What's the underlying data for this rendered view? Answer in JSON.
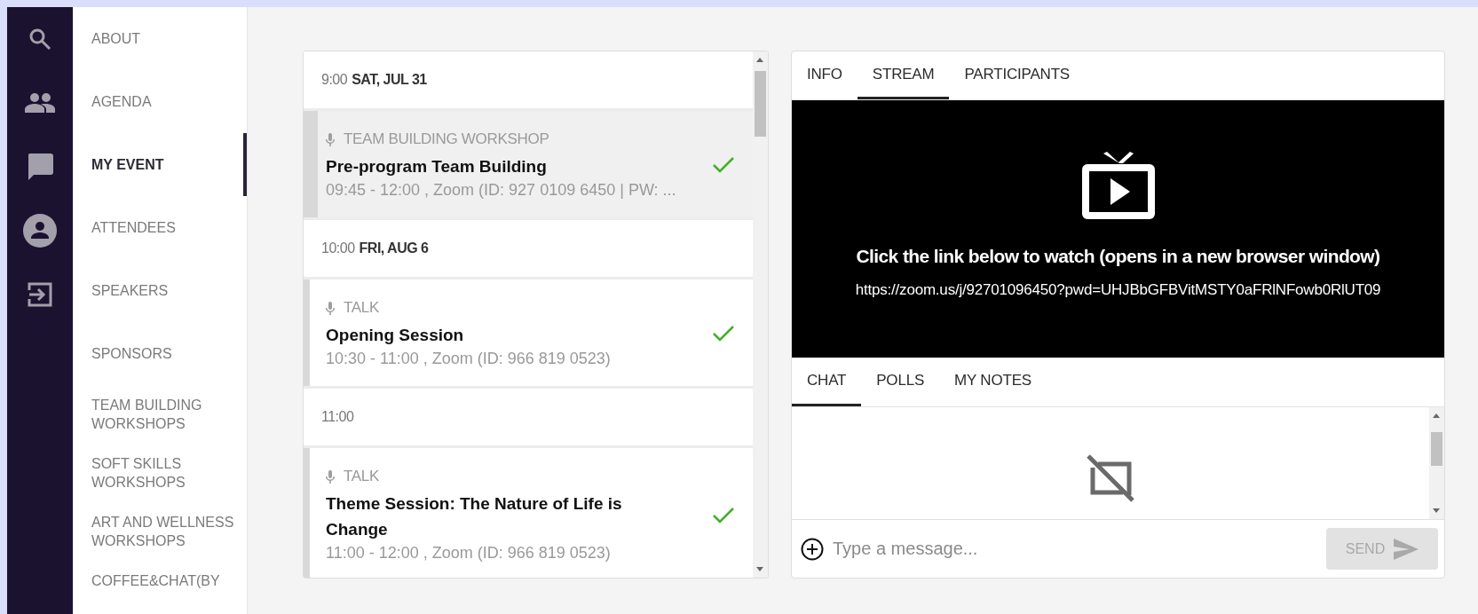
{
  "icon_bar": [
    {
      "kind": "search"
    },
    {
      "kind": "people"
    },
    {
      "kind": "chat"
    },
    {
      "kind": "account"
    },
    {
      "kind": "login"
    }
  ],
  "menu": [
    {
      "label": "ABOUT",
      "selected": false
    },
    {
      "label": "AGENDA",
      "selected": false
    },
    {
      "label": "MY EVENT",
      "selected": true
    },
    {
      "label": "ATTENDEES",
      "selected": false
    },
    {
      "label": "SPEAKERS",
      "selected": false
    },
    {
      "label": "SPONSORS",
      "selected": false
    },
    {
      "label": "TEAM BUILDING WORKSHOPS",
      "selected": false
    },
    {
      "label": "SOFT SKILLS WORKSHOPS",
      "selected": false
    },
    {
      "label": "ART AND WELLNESS WORKSHOPS",
      "selected": false
    },
    {
      "label": "COFFEE&CHAT(BY",
      "selected": false
    }
  ],
  "schedule": [
    {
      "kind": "header",
      "time": "9:00",
      "date": "SAT, JUL 31"
    },
    {
      "kind": "session",
      "category": "TEAM BUILDING WORKSHOP",
      "title": "Pre-program Team Building",
      "details": "09:45 - 12:00 , Zoom (ID: 927 0109 6450 | PW: ...",
      "selected": true,
      "added": true
    },
    {
      "kind": "header",
      "time": "10:00",
      "date": "FRI, AUG 6"
    },
    {
      "kind": "session",
      "category": "TALK",
      "title": "Opening Session",
      "details": "10:30 - 11:00 , Zoom (ID: 966 819 0523)",
      "selected": false,
      "added": true
    },
    {
      "kind": "header",
      "time": "11:00"
    },
    {
      "kind": "session",
      "category": "TALK",
      "title": "Theme Session: The Nature of Life is Change",
      "details": "11:00 - 12:00 , Zoom (ID: 966 819 0523)",
      "selected": false,
      "added": true
    }
  ],
  "detail_tabs": [
    {
      "label": "INFO",
      "selected": false
    },
    {
      "label": "STREAM",
      "selected": true
    },
    {
      "label": "PARTICIPANTS",
      "selected": false
    }
  ],
  "stream": {
    "message": "Click the link below to watch (opens in a new browser window)",
    "link": "https://zoom.us/j/92701096450?pwd=UHJBbGFBVitMSTY0aFRlNFowb0RlUT09"
  },
  "chat_tabs": [
    {
      "label": "CHAT",
      "selected": true
    },
    {
      "label": "POLLS",
      "selected": false
    },
    {
      "label": "MY NOTES",
      "selected": false
    }
  ],
  "chat": {
    "placeholder": "Type a message...",
    "send": "SEND",
    "send_disabled": true
  }
}
